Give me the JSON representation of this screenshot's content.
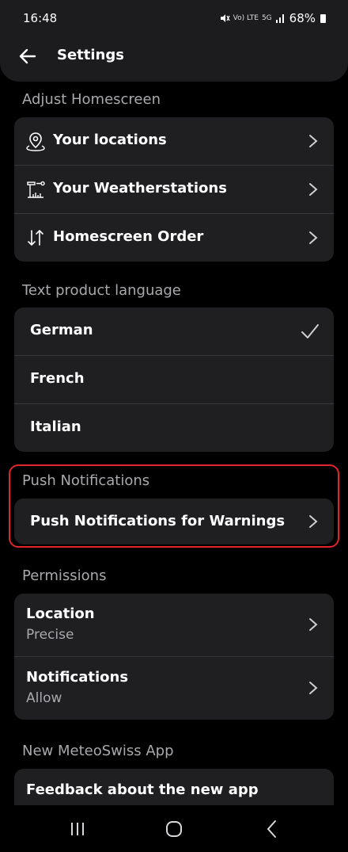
{
  "status_bar": {
    "time": "16:48",
    "network_mini": "Vo) LTE",
    "network_5g": "5G",
    "battery": "68%"
  },
  "header": {
    "title": "Settings"
  },
  "sections": {
    "homescreen": {
      "label": "Adjust Homescreen",
      "items": [
        {
          "label": "Your locations",
          "icon": "location-pin-icon"
        },
        {
          "label": "Your Weatherstations",
          "icon": "weatherstation-icon"
        },
        {
          "label": "Homescreen Order",
          "icon": "sort-arrows-icon"
        }
      ]
    },
    "language": {
      "label": "Text product language",
      "items": [
        {
          "label": "German",
          "selected": true
        },
        {
          "label": "French",
          "selected": false
        },
        {
          "label": "Italian",
          "selected": false
        }
      ]
    },
    "push": {
      "label": "Push Notifications",
      "items": [
        {
          "label": "Push Notifications for Warnings"
        }
      ]
    },
    "permissions": {
      "label": "Permissions",
      "items": [
        {
          "label": "Location",
          "value": "Precise"
        },
        {
          "label": "Notifications",
          "value": "Allow"
        }
      ]
    },
    "app": {
      "label": "New MeteoSwiss App",
      "items": [
        {
          "label": "Feedback about the new app"
        }
      ]
    }
  },
  "colors": {
    "highlight": "#e0252b",
    "card": "#1f1f22",
    "muted_text": "#a9a9ad"
  }
}
